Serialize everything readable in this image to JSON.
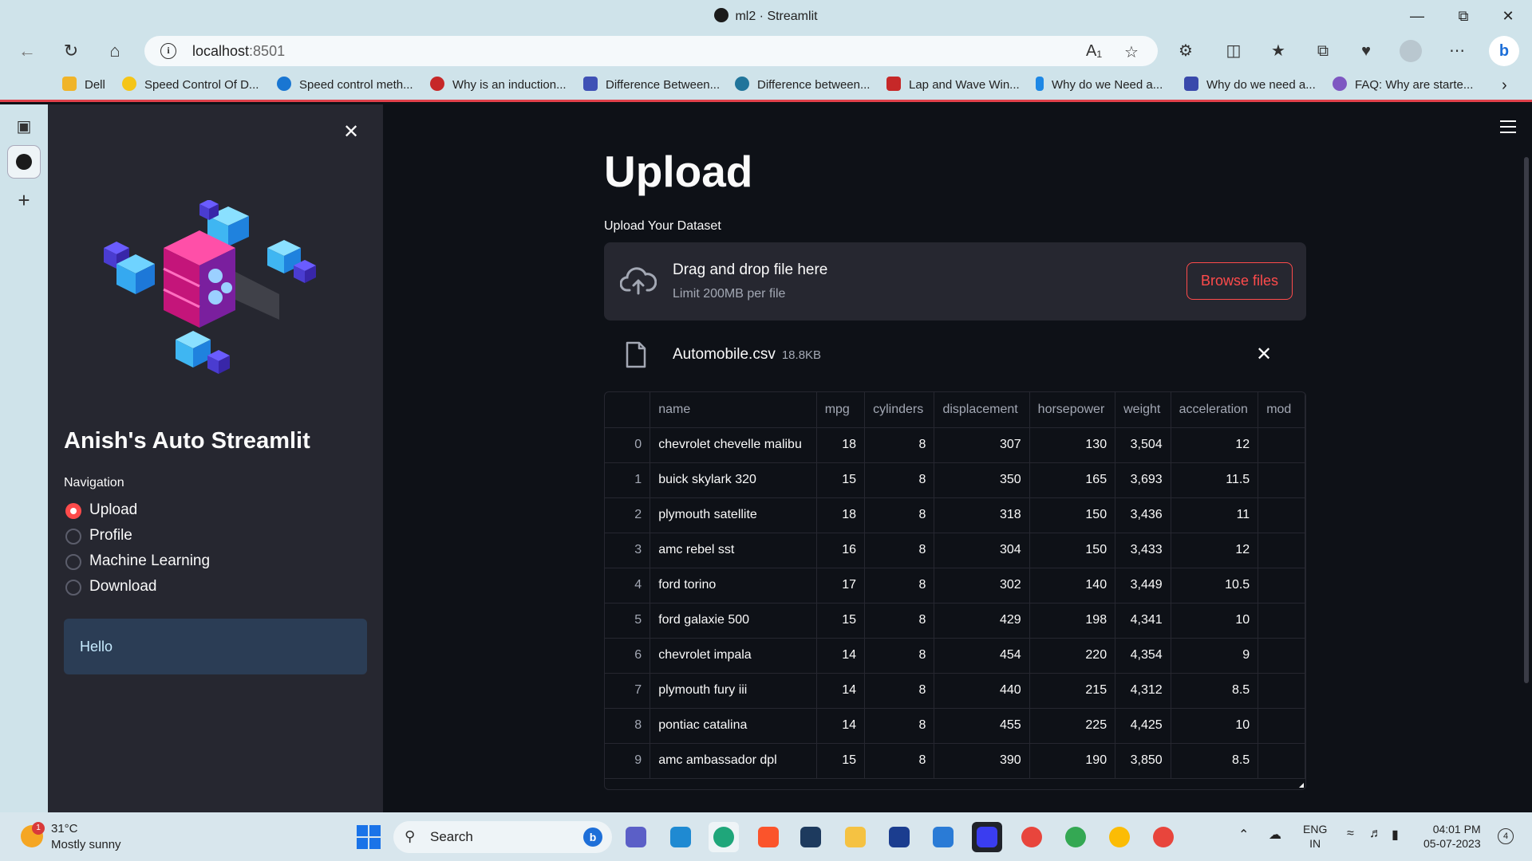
{
  "browser": {
    "window_title": "ml2 · Streamlit",
    "url_host": "localhost",
    "url_port": ":8501",
    "bookmarks": [
      {
        "label": "Dell",
        "color": "#f0b429"
      },
      {
        "label": "Speed Control Of D...",
        "color": "#f5c518"
      },
      {
        "label": "Speed control meth...",
        "color": "#1976d2"
      },
      {
        "label": "Why is an induction...",
        "color": "#c62828"
      },
      {
        "label": "Difference Between...",
        "color": "#3f51b5"
      },
      {
        "label": "Difference between...",
        "color": "#21759b"
      },
      {
        "label": "Lap and Wave Win...",
        "color": "#c62828"
      },
      {
        "label": "Why do we Need a...",
        "color": "#1e88e5"
      },
      {
        "label": "Why do we need a...",
        "color": "#3949ab"
      },
      {
        "label": "FAQ: Why are starte...",
        "color": "#7e57c2"
      }
    ]
  },
  "sidebar": {
    "app_title": "Anish's Auto Streamlit",
    "nav_label": "Navigation",
    "options": [
      "Upload",
      "Profile",
      "Machine Learning",
      "Download"
    ],
    "selected": "Upload",
    "info_text": "Hello"
  },
  "main": {
    "title": "Upload",
    "uploader_label": "Upload Your Dataset",
    "drop_text": "Drag and drop file here",
    "limit_text": "Limit 200MB per file",
    "browse_label": "Browse files",
    "file_name": "Automobile.csv",
    "file_size": "18.8KB"
  },
  "table": {
    "columns": [
      "",
      "name",
      "mpg",
      "cylinders",
      "displacement",
      "horsepower",
      "weight",
      "acceleration",
      "mod"
    ],
    "rows": [
      [
        "0",
        "chevrolet chevelle malibu",
        "18",
        "8",
        "307",
        "130",
        "3,504",
        "12",
        ""
      ],
      [
        "1",
        "buick skylark 320",
        "15",
        "8",
        "350",
        "165",
        "3,693",
        "11.5",
        ""
      ],
      [
        "2",
        "plymouth satellite",
        "18",
        "8",
        "318",
        "150",
        "3,436",
        "11",
        ""
      ],
      [
        "3",
        "amc rebel sst",
        "16",
        "8",
        "304",
        "150",
        "3,433",
        "12",
        ""
      ],
      [
        "4",
        "ford torino",
        "17",
        "8",
        "302",
        "140",
        "3,449",
        "10.5",
        ""
      ],
      [
        "5",
        "ford galaxie 500",
        "15",
        "8",
        "429",
        "198",
        "4,341",
        "10",
        ""
      ],
      [
        "6",
        "chevrolet impala",
        "14",
        "8",
        "454",
        "220",
        "4,354",
        "9",
        ""
      ],
      [
        "7",
        "plymouth fury iii",
        "14",
        "8",
        "440",
        "215",
        "4,312",
        "8.5",
        ""
      ],
      [
        "8",
        "pontiac catalina",
        "14",
        "8",
        "455",
        "225",
        "4,425",
        "10",
        ""
      ],
      [
        "9",
        "amc ambassador dpl",
        "15",
        "8",
        "390",
        "190",
        "3,850",
        "8.5",
        ""
      ]
    ]
  },
  "taskbar": {
    "weather_badge": "1",
    "temperature": "31°C",
    "condition": "Mostly sunny",
    "search_label": "Search",
    "lang_1": "ENG",
    "lang_2": "IN",
    "time": "04:01 PM",
    "date": "05-07-2023",
    "notifications": "4"
  },
  "colors": {
    "accent": "#ff4b4b",
    "sidebar_bg": "#262730",
    "main_bg": "#0e1117",
    "info_bg": "#2b3d55"
  }
}
